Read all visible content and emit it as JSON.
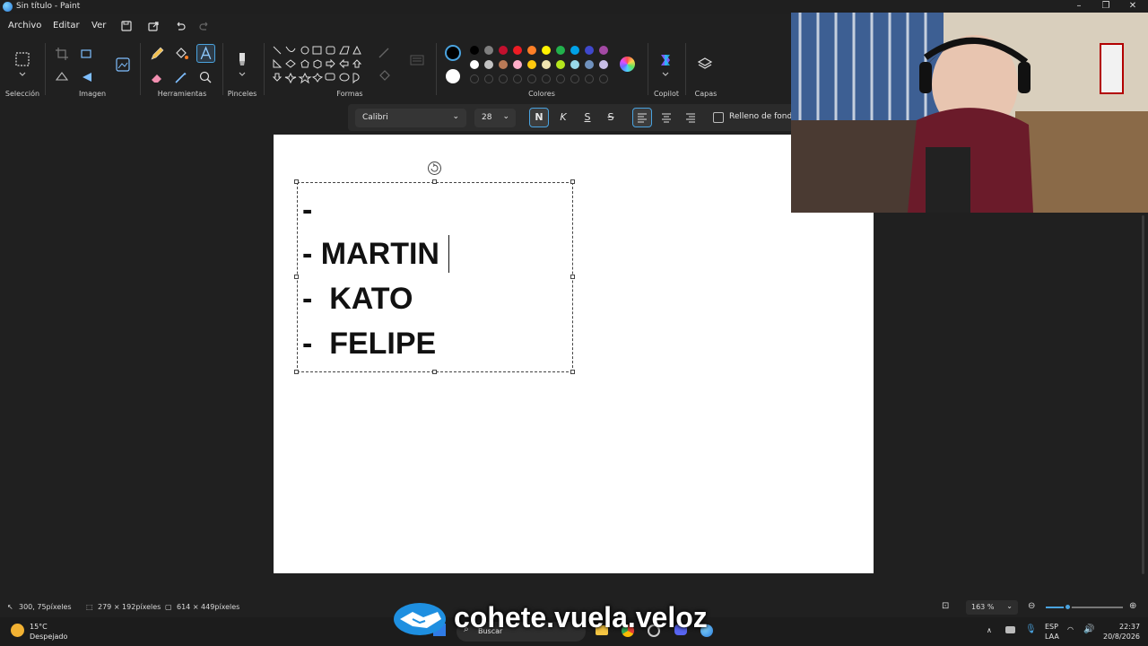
{
  "window": {
    "title": "Sin título - Paint"
  },
  "menu": {
    "archivo": "Archivo",
    "editar": "Editar",
    "ver": "Ver"
  },
  "ribbon": {
    "groups": {
      "seleccion": "Selección",
      "imagen": "Imagen",
      "herramientas": "Herramientas",
      "pinceles": "Pinceles",
      "formas": "Formas",
      "colores": "Colores",
      "copilot": "Copilot",
      "capas": "Capas"
    },
    "palette_row1": [
      "#000000",
      "#7f7f7f",
      "#c3102e",
      "#ed1c24",
      "#ff7f27",
      "#fff200",
      "#22b14c",
      "#00a2e8",
      "#3f48cc",
      "#a349a4"
    ],
    "palette_row2": [
      "#ffffff",
      "#c3c3c3",
      "#b97a57",
      "#ffaec9",
      "#ffc90e",
      "#efe4b0",
      "#b5e61d",
      "#99d9ea",
      "#7092be",
      "#c8bfe7"
    ],
    "current_color": "#000000",
    "secondary_color": "#ffffff"
  },
  "text_toolbar": {
    "font": "Calibri",
    "size": "28",
    "bold": "N",
    "italic": "K",
    "underline": "S",
    "strike": "S",
    "fill_label": "Relleno de fondo"
  },
  "canvas_text": {
    "line1": "-",
    "line2": "- MARTIN",
    "line3": "-  KATO",
    "line4": "-  FELIPE"
  },
  "status": {
    "cursor": "300, 75píxeles",
    "selection": "279 × 192píxeles",
    "canvas_size": "614 × 449píxeles",
    "zoom": "163 %",
    "zoom_level": 0.3
  },
  "taskbar": {
    "temperature": "15°C",
    "weather": "Despejado",
    "search": "Buscar",
    "lang": "ESP",
    "layout": "LAA",
    "time": "22:37",
    "date": "20/8/2026"
  },
  "watermark": {
    "text": "cohete.vuela.veloz"
  }
}
